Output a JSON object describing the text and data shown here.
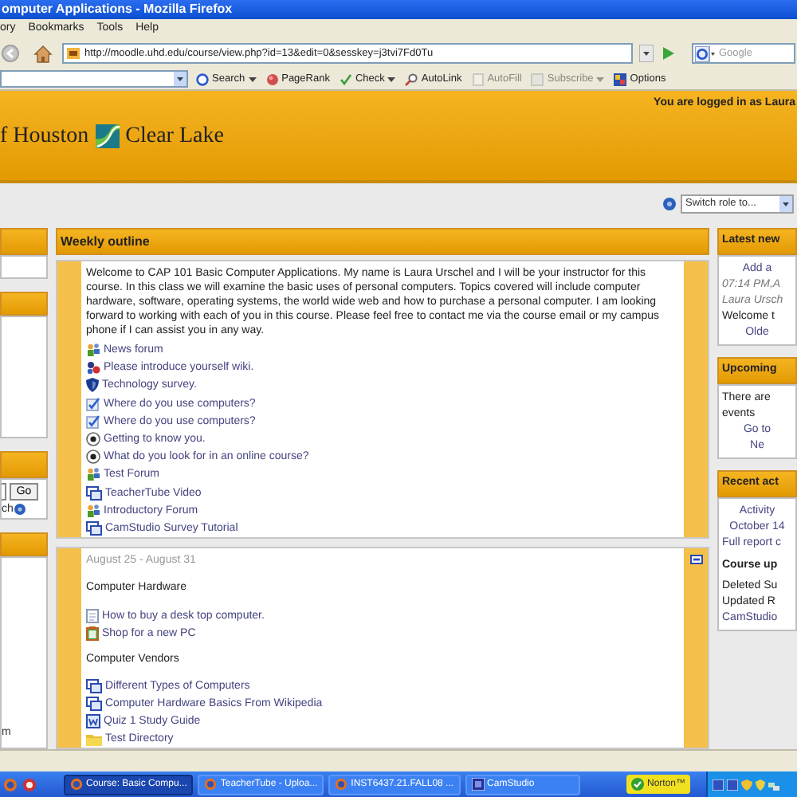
{
  "window": {
    "title": "omputer Applications - Mozilla Firefox"
  },
  "menu": [
    {
      "label": "ory"
    },
    {
      "label": "Bookmarks"
    },
    {
      "label": "Tools"
    },
    {
      "label": "Help"
    }
  ],
  "address_bar": {
    "url": "http://moodle.uhd.edu/course/view.php?id=13&edit=0&sesskey=j3tvi7Fd0Tu"
  },
  "search_box": {
    "placeholder": "Google"
  },
  "toolbar": [
    {
      "label": "Search",
      "kind": "dropdown",
      "disabled": false
    },
    {
      "label": "PageRank",
      "kind": "button",
      "disabled": false
    },
    {
      "label": "Check",
      "kind": "dropdown",
      "disabled": false
    },
    {
      "label": "AutoLink",
      "kind": "button",
      "disabled": false
    },
    {
      "label": "AutoFill",
      "kind": "button",
      "disabled": true
    },
    {
      "label": "Subscribe",
      "kind": "dropdown",
      "disabled": true
    },
    {
      "label": "Options",
      "kind": "button",
      "disabled": false
    }
  ],
  "header": {
    "logo_left": "f Houston",
    "logo_right": "Clear Lake",
    "login_text": "You are logged in as Laura"
  },
  "role_switch": {
    "value": "Switch role to..."
  },
  "left_column": {
    "go_button": "Go",
    "search_link": "ch",
    "link": "m"
  },
  "weekly_outline": {
    "title": "Weekly outline",
    "sections": [
      {
        "summary": "Welcome to CAP 101 Basic Computer Applications. My name is Laura Urschel and I will be your instructor for this course. In this class we will examine the basic uses of personal computers. Topics covered will include computer hardware, software, operating systems, the world wide web and how to purchase a personal computer. I am looking forward to working with each of you in this course. Please feel free to contact me via the course email or my campus phone if I can assist you in any way.",
        "items": [
          {
            "kind": "forum",
            "label": "News forum"
          },
          {
            "kind": "wiki",
            "label": "Please introduce yourself wiki."
          },
          {
            "kind": "survey",
            "label": "Technology survey."
          },
          {
            "kind": "questionnaire",
            "label": "Where do you use computers?"
          },
          {
            "kind": "questionnaire",
            "label": "Where do you use computers?"
          },
          {
            "kind": "choice",
            "label": "Getting to know you."
          },
          {
            "kind": "choice",
            "label": "What do you look for in an online course?"
          },
          {
            "kind": "forum",
            "label": "Test Forum"
          },
          {
            "kind": "link",
            "label": "TeacherTube Video"
          },
          {
            "kind": "forum",
            "label": "Introductory Forum"
          },
          {
            "kind": "link",
            "label": "CamStudio Survey Tutorial"
          }
        ]
      },
      {
        "date": "August 25 - August 31",
        "items": [
          {
            "kind": "label",
            "label": "Computer Hardware"
          },
          {
            "kind": "page",
            "label": "How to buy a desk top computer."
          },
          {
            "kind": "resource",
            "label": "Shop for a new PC"
          },
          {
            "kind": "label",
            "label": "Computer Vendors"
          },
          {
            "kind": "link",
            "label": "Different Types of Computers"
          },
          {
            "kind": "link",
            "label": "Computer Hardware Basics From Wikipedia"
          },
          {
            "kind": "word",
            "label": "Quiz 1 Study Guide"
          },
          {
            "kind": "folder",
            "label": "Test Directory"
          }
        ]
      }
    ]
  },
  "right_column": [
    {
      "title": "Latest new",
      "lines": [
        {
          "kind": "center",
          "text": "Add a"
        },
        {
          "kind": "meta",
          "text": "07:14 PM,A"
        },
        {
          "kind": "meta",
          "text": "Laura Ursch"
        },
        {
          "kind": "text",
          "text": "Welcome t"
        },
        {
          "kind": "center",
          "text": "Olde"
        }
      ]
    },
    {
      "title": "Upcoming",
      "lines": [
        {
          "kind": "text",
          "text": "There are"
        },
        {
          "kind": "text",
          "text": "events"
        },
        {
          "kind": "center",
          "text": "Go to"
        },
        {
          "kind": "center",
          "text": "Ne"
        }
      ]
    },
    {
      "title": "Recent act",
      "lines": [
        {
          "kind": "center",
          "text": "Activity"
        },
        {
          "kind": "center",
          "text": "October 14"
        },
        {
          "kind": "link",
          "text": "Full report c"
        },
        {
          "kind": "bold",
          "text": "Course up"
        },
        {
          "kind": "text",
          "text": "Deleted Su"
        },
        {
          "kind": "text",
          "text": "Updated R"
        },
        {
          "kind": "link",
          "text": "CamStudio"
        }
      ]
    }
  ],
  "taskbar": {
    "buttons": [
      {
        "label": "Course: Basic Compu...",
        "selected": true,
        "kind": "browser"
      },
      {
        "label": "TeacherTube - Uploa...",
        "selected": false,
        "kind": "browser"
      },
      {
        "label": "INST6437.21.FALL08 ...",
        "selected": false,
        "kind": "browser"
      },
      {
        "label": "CamStudio",
        "selected": false,
        "kind": "recorder"
      }
    ],
    "norton": "Norton™"
  }
}
